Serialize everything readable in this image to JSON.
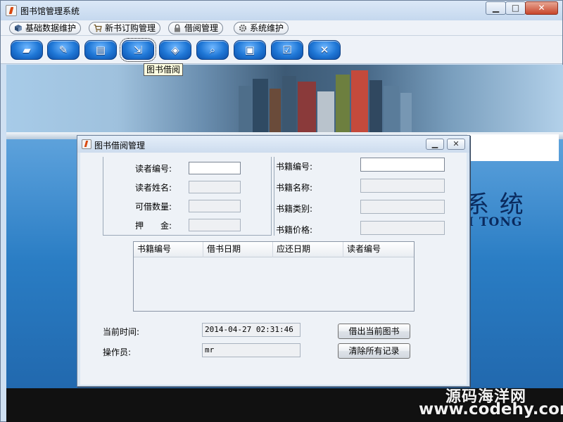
{
  "window": {
    "title": "图书馆管理系统"
  },
  "menu": [
    {
      "label": "基础数据维护",
      "icon": "database-icon"
    },
    {
      "label": "新书订购管理",
      "icon": "cart-icon"
    },
    {
      "label": "借阅管理",
      "icon": "lock-icon"
    },
    {
      "label": "系统维护",
      "icon": "gear-icon"
    }
  ],
  "toolbar": {
    "buttons": [
      "book-icon",
      "pen-icon",
      "card-icon",
      "borrow-icon",
      "box-icon",
      "magnifier-icon",
      "monitor-icon",
      "checklist-icon",
      "exit-icon"
    ],
    "active_index": 3,
    "tooltip": "图书借阅"
  },
  "background": {
    "brand_cn": "系 统",
    "brand_en": "I TONG",
    "watermark_cn": "源码海洋网",
    "watermark_url": "www.codehy.com"
  },
  "dialog": {
    "title": "图书借阅管理",
    "reader": {
      "id_label": "读者编号:",
      "id_value": "",
      "name_label": "读者姓名:",
      "name_value": "",
      "quota_label": "可借数量:",
      "quota_value": "",
      "deposit_label": "押　　金:",
      "deposit_value": ""
    },
    "book": {
      "id_label": "书籍编号:",
      "id_value": "",
      "name_label": "书籍名称:",
      "name_value": "",
      "type_label": "书籍类别:",
      "type_value": "",
      "price_label": "书籍价格:",
      "price_value": ""
    },
    "table": {
      "columns": [
        "书籍编号",
        "借书日期",
        "应还日期",
        "读者编号"
      ],
      "rows": []
    },
    "current_time_label": "当前时间:",
    "current_time_value": "2014-04-27 02:31:46",
    "operator_label": "操作员:",
    "operator_value": "mr",
    "borrow_button": "借出当前图书",
    "clear_button": "清除所有记录"
  }
}
